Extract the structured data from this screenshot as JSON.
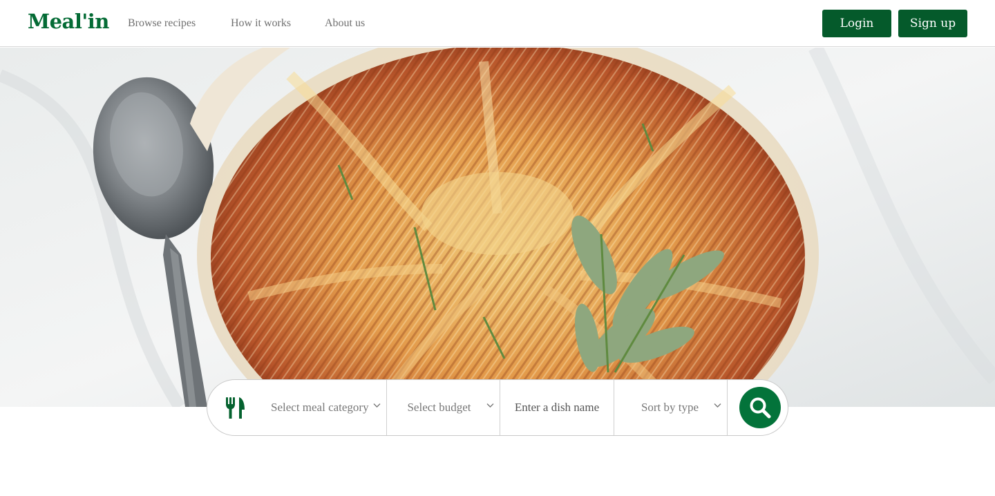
{
  "brand": {
    "name": "Meal'in",
    "color": "#046b35"
  },
  "nav": {
    "items": [
      {
        "label": "Browse recipes"
      },
      {
        "label": "How it works"
      },
      {
        "label": "About us"
      }
    ]
  },
  "auth": {
    "login_label": "Login",
    "signup_label": "Sign up",
    "button_color": "#055a2b"
  },
  "hero": {
    "image_subject": "hasselback potato gratin with sage in baking dish beside a spoon"
  },
  "search": {
    "category_icon": "fork-knife-icon",
    "category_placeholder": "Select meal category",
    "budget_placeholder": "Select budget",
    "dish_placeholder": "Enter a dish name",
    "sort_placeholder": "Sort by type",
    "submit_icon": "search-icon",
    "accent_color": "#03733a"
  }
}
